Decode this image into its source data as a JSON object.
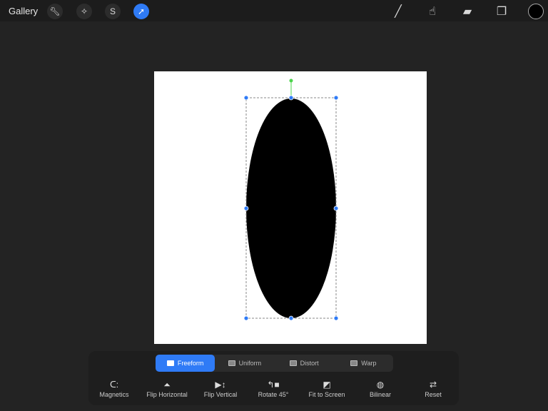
{
  "topbar": {
    "gallery": "Gallery",
    "tools": [
      "wrench-icon",
      "magic-wand-icon",
      "selection-s-icon",
      "transform-arrow-icon"
    ],
    "active_tool": "transform-arrow-icon",
    "right": [
      "brush-icon",
      "smudge-icon",
      "eraser-icon",
      "layers-icon"
    ],
    "current_color": "#000000"
  },
  "modes": [
    {
      "label": "Freeform",
      "active": true
    },
    {
      "label": "Uniform"
    },
    {
      "label": "Distort"
    },
    {
      "label": "Warp"
    }
  ],
  "tools": [
    {
      "label": "Magnetics",
      "icon": "magnet-icon"
    },
    {
      "label": "Flip Horizontal",
      "icon": "flip-horizontal-icon"
    },
    {
      "label": "Flip Vertical",
      "icon": "flip-vertical-icon"
    },
    {
      "label": "Rotate 45°",
      "icon": "rotate-icon"
    },
    {
      "label": "Fit to Screen",
      "icon": "fit-screen-icon"
    },
    {
      "label": "Bilinear",
      "icon": "bilinear-icon"
    },
    {
      "label": "Reset",
      "icon": "reset-icon"
    }
  ],
  "accent": "#2f7bf6"
}
